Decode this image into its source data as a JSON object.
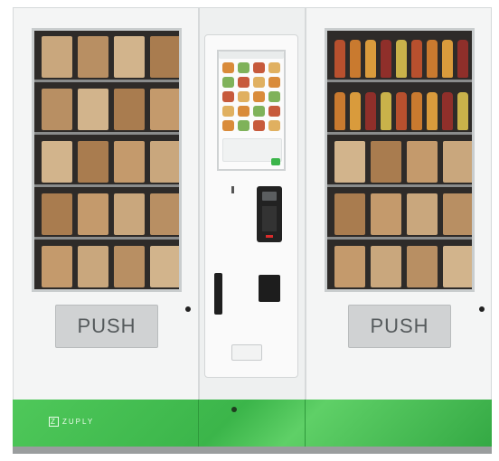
{
  "machine": {
    "left_door": {
      "push_label": "PUSH"
    },
    "right_door": {
      "push_label": "PUSH"
    },
    "brand": {
      "name": "ZUPLY",
      "mark": "Z"
    }
  },
  "colors": {
    "base_green": "#3bb54a",
    "cabinet": "#f4f5f5",
    "window_dark": "#2e2b29",
    "push_panel": "#d0d2d3"
  }
}
